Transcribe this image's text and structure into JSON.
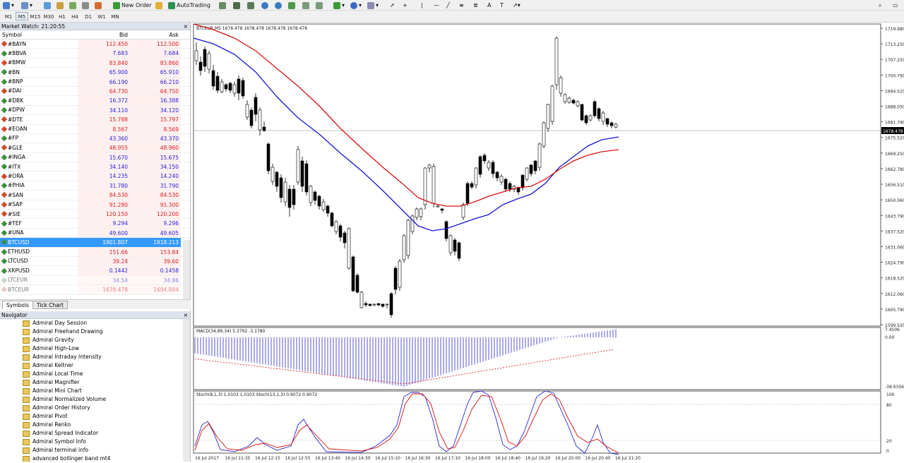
{
  "toolbar": {
    "new_order": "New Order",
    "auto_trading": "AutoTrading"
  },
  "timeframes": [
    "M1",
    "M5",
    "M15",
    "M30",
    "H1",
    "H4",
    "D1",
    "W1",
    "MN"
  ],
  "market_watch": {
    "title": "Market Watch: 21:20:55",
    "close": "×",
    "col_symbol": "Symbol",
    "col_bid": "Bid",
    "col_ask": "Ask",
    "rows": [
      {
        "symbol": "#BAYN",
        "bid": "112.450",
        "ask": "112.500",
        "bidc": "#d81e1e",
        "askc": "#d81e1e",
        "dot": "#d24a2a"
      },
      {
        "symbol": "#BBVA",
        "bid": "7.683",
        "ask": "7.684",
        "bidc": "#1e1ed8",
        "askc": "#1e1ed8",
        "dot": "#3b8f3b"
      },
      {
        "symbol": "#BMW",
        "bid": "83.840",
        "ask": "83.860",
        "bidc": "#d81e1e",
        "askc": "#d81e1e",
        "dot": "#d24a2a"
      },
      {
        "symbol": "#BN",
        "bid": "65.900",
        "ask": "65.910",
        "bidc": "#1e1ed8",
        "askc": "#1e1ed8",
        "dot": "#3b8f3b"
      },
      {
        "symbol": "#BNP",
        "bid": "66.190",
        "ask": "66.210",
        "bidc": "#1e1ed8",
        "askc": "#1e1ed8",
        "dot": "#3b8f3b"
      },
      {
        "symbol": "#DAI",
        "bid": "64.730",
        "ask": "64.750",
        "bidc": "#d81e1e",
        "askc": "#d81e1e",
        "dot": "#d24a2a"
      },
      {
        "symbol": "#DBK",
        "bid": "16.372",
        "ask": "16.388",
        "bidc": "#1e1ed8",
        "askc": "#1e1ed8",
        "dot": "#3b8f3b"
      },
      {
        "symbol": "#DPW",
        "bid": "34.110",
        "ask": "34.120",
        "bidc": "#1e1ed8",
        "askc": "#1e1ed8",
        "dot": "#3b8f3b"
      },
      {
        "symbol": "#DTE",
        "bid": "15.788",
        "ask": "15.797",
        "bidc": "#d81e1e",
        "askc": "#d81e1e",
        "dot": "#d24a2a"
      },
      {
        "symbol": "#EOAN",
        "bid": "8.567",
        "ask": "8.569",
        "bidc": "#d81e1e",
        "askc": "#d81e1e",
        "dot": "#d24a2a"
      },
      {
        "symbol": "#FP",
        "bid": "43.360",
        "ask": "43.370",
        "bidc": "#1e1ed8",
        "askc": "#1e1ed8",
        "dot": "#3b8f3b"
      },
      {
        "symbol": "#GLE",
        "bid": "48.955",
        "ask": "48.960",
        "bidc": "#d81e1e",
        "askc": "#d81e1e",
        "dot": "#d24a2a"
      },
      {
        "symbol": "#INGA",
        "bid": "15.670",
        "ask": "15.675",
        "bidc": "#1e1ed8",
        "askc": "#1e1ed8",
        "dot": "#3b8f3b"
      },
      {
        "symbol": "#ITX",
        "bid": "34.140",
        "ask": "34.150",
        "bidc": "#1e1ed8",
        "askc": "#1e1ed8",
        "dot": "#3b8f3b"
      },
      {
        "symbol": "#ORA",
        "bid": "14.235",
        "ask": "14.240",
        "bidc": "#1e1ed8",
        "askc": "#1e1ed8",
        "dot": "#d24a2a"
      },
      {
        "symbol": "#PHIA",
        "bid": "31.780",
        "ask": "31.790",
        "bidc": "#1e1ed8",
        "askc": "#1e1ed8",
        "dot": "#3b8f3b"
      },
      {
        "symbol": "#SAN",
        "bid": "84.530",
        "ask": "84.530",
        "bidc": "#d81e1e",
        "askc": "#d81e1e",
        "dot": "#d24a2a"
      },
      {
        "symbol": "#SAP",
        "bid": "91.280",
        "ask": "91.300",
        "bidc": "#d81e1e",
        "askc": "#d81e1e",
        "dot": "#d24a2a"
      },
      {
        "symbol": "#SIE",
        "bid": "120.150",
        "ask": "120.200",
        "bidc": "#d81e1e",
        "askc": "#d81e1e",
        "dot": "#d24a2a"
      },
      {
        "symbol": "#TEF",
        "bid": "9.294",
        "ask": "9.296",
        "bidc": "#1e1ed8",
        "askc": "#1e1ed8",
        "dot": "#3b8f3b"
      },
      {
        "symbol": "#UNA",
        "bid": "49.600",
        "ask": "49.605",
        "bidc": "#1e1ed8",
        "askc": "#1e1ed8",
        "dot": "#3b8f3b"
      },
      {
        "symbol": "BTCUSD",
        "bid": "1901.807",
        "ask": "1918.213",
        "bidc": "#ffffff",
        "askc": "#ffffff",
        "dot": "#3b8f3b",
        "selected": true
      },
      {
        "symbol": "ETHUSD",
        "bid": "151.66",
        "ask": "153.84",
        "bidc": "#d81e1e",
        "askc": "#d81e1e",
        "dot": "#3b8f3b"
      },
      {
        "symbol": "LTCUSD",
        "bid": "39.24",
        "ask": "39.60",
        "bidc": "#d81e1e",
        "askc": "#d81e1e",
        "dot": "#3b8f3b"
      },
      {
        "symbol": "XRPUSD",
        "bid": "0.1442",
        "ask": "0.1458",
        "bidc": "#1e1ed8",
        "askc": "#1e1ed8",
        "dot": "#3b8f3b"
      },
      {
        "symbol": "LTCEUR",
        "bid": "34.54",
        "ask": "34.86",
        "bidc": "#1e1ed8",
        "askc": "#1e1ed8",
        "dot": "#9ab89a",
        "muted": true
      },
      {
        "symbol": "BTCEUR",
        "bid": "1678.478",
        "ask": "1694.884",
        "bidc": "#d81e1e",
        "askc": "#d81e1e",
        "dot": "#d8a090",
        "muted": true
      }
    ],
    "tabs": [
      "Symbols",
      "Tick Chart"
    ]
  },
  "navigator": {
    "title": "Navigator",
    "close": "×",
    "items": [
      "Admiral Day Session",
      "Admiral Freehand Drawing",
      "Admiral Gravity",
      "Admiral High-Low",
      "Admiral Intraday Intensity",
      "Admiral Keltner",
      "Admiral Local Time",
      "Admiral Magnifier",
      "Admiral Mini Chart",
      "Admiral Normalized Volume",
      "Admiral Order History",
      "Admiral Pivot",
      "Admiral Renko",
      "Admiral Spread Indicator",
      "Admiral Symbol Info",
      "Admiral terminal info",
      "advanced bollinger band mt4"
    ]
  },
  "chart": {
    "header": "BTCEUR,M5  1678.478 1678.478 1678.478 1678.478",
    "price_labels": [
      "1719.980",
      "1713.250",
      "1707.250",
      "1700.790",
      "1694.520",
      "1688.050",
      "1681.790",
      "1675.520",
      "1669.250",
      "1662.780",
      "1656.510",
      "1650.060",
      "1643.790",
      "1637.520",
      "1631.060",
      "1624.790",
      "1618.520",
      "1612.060",
      "1605.790",
      "1599.520"
    ],
    "current_price": "1678.478",
    "macd_label": "MACD(34,89,34) 5.3792 -3.1780",
    "macd_scale": [
      "7.4506",
      "0.00",
      "-38.6356"
    ],
    "stoch_label": "Stoch(8,1,3) 1.0103 1.0103  Stoch(13,1,3) 0.9072 0.9072",
    "stoch_scale": [
      "100",
      "80",
      "20",
      "0"
    ],
    "time_labels": [
      "16 Jul 2017",
      "16 Jul 11:35",
      "16 Jul 12:15",
      "16 Jul 12:55",
      "16 Jul 13:40",
      "16 Jul 14:30",
      "16 Jul 15:10",
      "16 Jul 16:30",
      "16 Jul 17:10",
      "16 Jul 18:00",
      "16 Jul 18:40",
      "16 Jul 19:20",
      "16 Jul 20:00",
      "16 Jul 20:40",
      "16 Jul 21:20"
    ]
  },
  "colors": {
    "ma_fast": "#1515d0",
    "ma_slow": "#d81010",
    "selection": "#3399ff"
  }
}
